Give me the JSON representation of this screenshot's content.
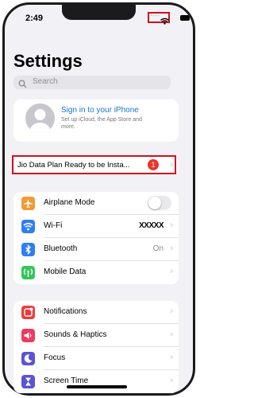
{
  "status_bar": {
    "time": "2:49",
    "signal_dots": "...."
  },
  "header": {
    "title": "Settings"
  },
  "search": {
    "placeholder": "Search"
  },
  "account": {
    "title": "Sign in to your iPhone",
    "subtitle": "Set up iCloud, the App Store and more."
  },
  "notice": {
    "label": "Jio Data Plan Ready to be Insta...",
    "badge": "1"
  },
  "group1": [
    {
      "label": "Airplane Mode",
      "value": "",
      "icon": "airplane-icon",
      "color": "#f19a37",
      "toggle": true,
      "enabled": false
    },
    {
      "label": "Wi-Fi",
      "value": "XXXXX",
      "icon": "wifi-icon",
      "color": "#2f7df6"
    },
    {
      "label": "Bluetooth",
      "value": "On",
      "icon": "bluetooth-icon",
      "color": "#2f7df6"
    },
    {
      "label": "Mobile Data",
      "value": "",
      "icon": "antenna-icon",
      "color": "#34c759"
    }
  ],
  "group2": [
    {
      "label": "Notifications",
      "icon": "bell-icon",
      "color": "#ee3b3b"
    },
    {
      "label": "Sounds & Haptics",
      "icon": "speaker-icon",
      "color": "#ee3b5c"
    },
    {
      "label": "Focus",
      "icon": "moon-icon",
      "color": "#5a54d6"
    },
    {
      "label": "Screen Time",
      "icon": "hourglass-icon",
      "color": "#5a54d6"
    }
  ]
}
